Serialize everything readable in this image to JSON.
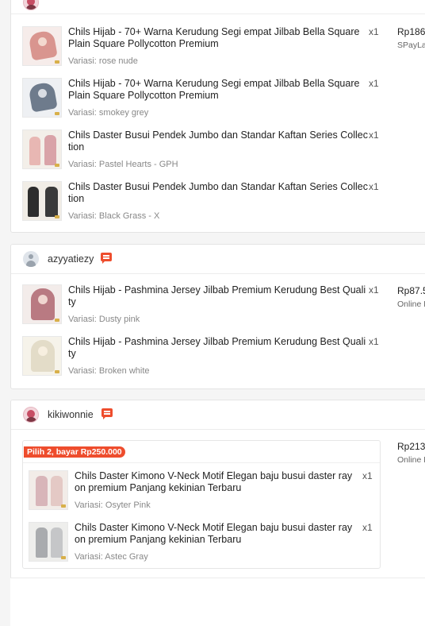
{
  "order1": {
    "items": [
      {
        "title": "Chils Hijab - 70+ Warna Kerudung Segi empat Jilbab Bella Square Plain Square Pollycotton Premium",
        "variant": "Variasi: rose nude",
        "qty": "x1"
      },
      {
        "title": "Chils Hijab - 70+ Warna Kerudung Segi empat Jilbab Bella Square Plain Square Pollycotton Premium",
        "variant": "Variasi: smokey grey",
        "qty": "x1"
      },
      {
        "title": "Chils Daster Busui Pendek Jumbo dan Standar Kaftan Series Collection",
        "variant": "Variasi: Pastel Hearts - GPH",
        "qty": "x1"
      },
      {
        "title": "Chils Daster Busui Pendek Jumbo dan Standar Kaftan Series Collection",
        "variant": "Variasi: Black Grass - X",
        "qty": "x1"
      }
    ],
    "price": "Rp186",
    "payment": "SPayLa"
  },
  "order2": {
    "username": "azyyatiezy",
    "items": [
      {
        "title": "Chils Hijab - Pashmina Jersey Jilbab Premium Kerudung Best Quality",
        "variant": "Variasi: Dusty pink",
        "qty": "x1"
      },
      {
        "title": "Chils Hijab - Pashmina Jersey Jilbab Premium Kerudung Best Quality",
        "variant": "Variasi: Broken white",
        "qty": "x1"
      }
    ],
    "price": "Rp87.5",
    "payment": "Online P"
  },
  "order3": {
    "username": "kikiwonnie",
    "promo": "Pilih 2, bayar Rp250.000",
    "items": [
      {
        "title": "Chils Daster Kimono V-Neck Motif Elegan baju busui daster rayon premium Panjang kekinian Terbaru",
        "variant": "Variasi: Osyter Pink",
        "qty": "x1"
      },
      {
        "title": "Chils Daster Kimono V-Neck Motif Elegan baju busui daster rayon premium Panjang kekinian Terbaru",
        "variant": "Variasi: Astec Gray",
        "qty": "x1"
      }
    ],
    "price": "Rp213",
    "payment": "Online P"
  },
  "colors": {
    "accent": "#ee4d2d",
    "promo": "#ee4d2d"
  },
  "icons": [
    "user-avatar-icon",
    "chat-icon"
  ]
}
